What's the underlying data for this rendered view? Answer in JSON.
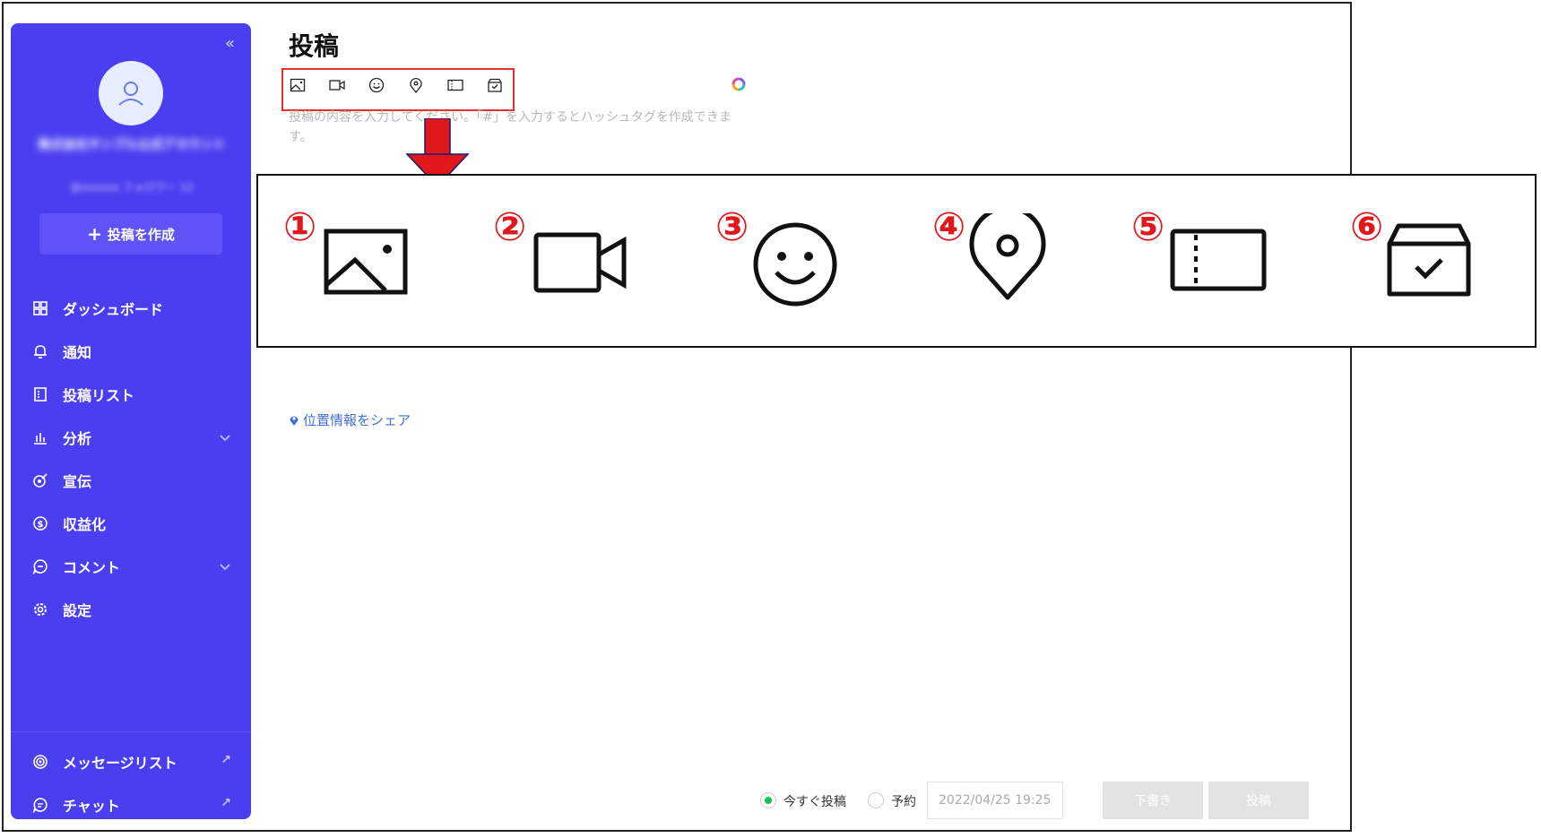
{
  "page": {
    "title": "投稿"
  },
  "sidebar": {
    "account_name": "株式会社サンプル公式アカウント",
    "account_id": "@xxxxxx フォロワー 12",
    "create_post_label": "投稿を作成",
    "items": [
      {
        "label": "ダッシュボード",
        "icon": "dashboard-icon"
      },
      {
        "label": "通知",
        "icon": "bell-icon"
      },
      {
        "label": "投稿リスト",
        "icon": "list-icon"
      },
      {
        "label": "分析",
        "icon": "chart-icon",
        "expandable": true
      },
      {
        "label": "宣伝",
        "icon": "promo-icon"
      },
      {
        "label": "収益化",
        "icon": "coin-icon"
      },
      {
        "label": "コメント",
        "icon": "comment-icon",
        "expandable": true
      },
      {
        "label": "設定",
        "icon": "gear-icon"
      }
    ],
    "bottom_items": [
      {
        "label": "メッセージリスト",
        "icon": "broadcast-icon",
        "external": true
      },
      {
        "label": "チャット",
        "icon": "chat-icon",
        "external": true
      }
    ]
  },
  "composer": {
    "placeholder": "投稿の内容を入力してください。「#」を入力するとハッシュタグを作成できます。",
    "toolbar_icons": [
      "image-icon",
      "video-icon",
      "emoji-icon",
      "location-pin-icon",
      "coupon-icon",
      "shop-icon"
    ],
    "location_share_label": "位置情報をシェア"
  },
  "annotation": {
    "numbers": [
      "①",
      "②",
      "③",
      "④",
      "⑤",
      "⑥"
    ],
    "accent_color": "#e0181e"
  },
  "footer": {
    "post_now_label": "今すぐ投稿",
    "schedule_label": "予約",
    "datetime_value": "2022/04/25 19:25",
    "draft_label": "下書き",
    "post_label": "投稿"
  },
  "colors": {
    "sidebar_bg": "#4a3ff0",
    "radio_selected": "#06c755",
    "link": "#3f6fd8"
  }
}
